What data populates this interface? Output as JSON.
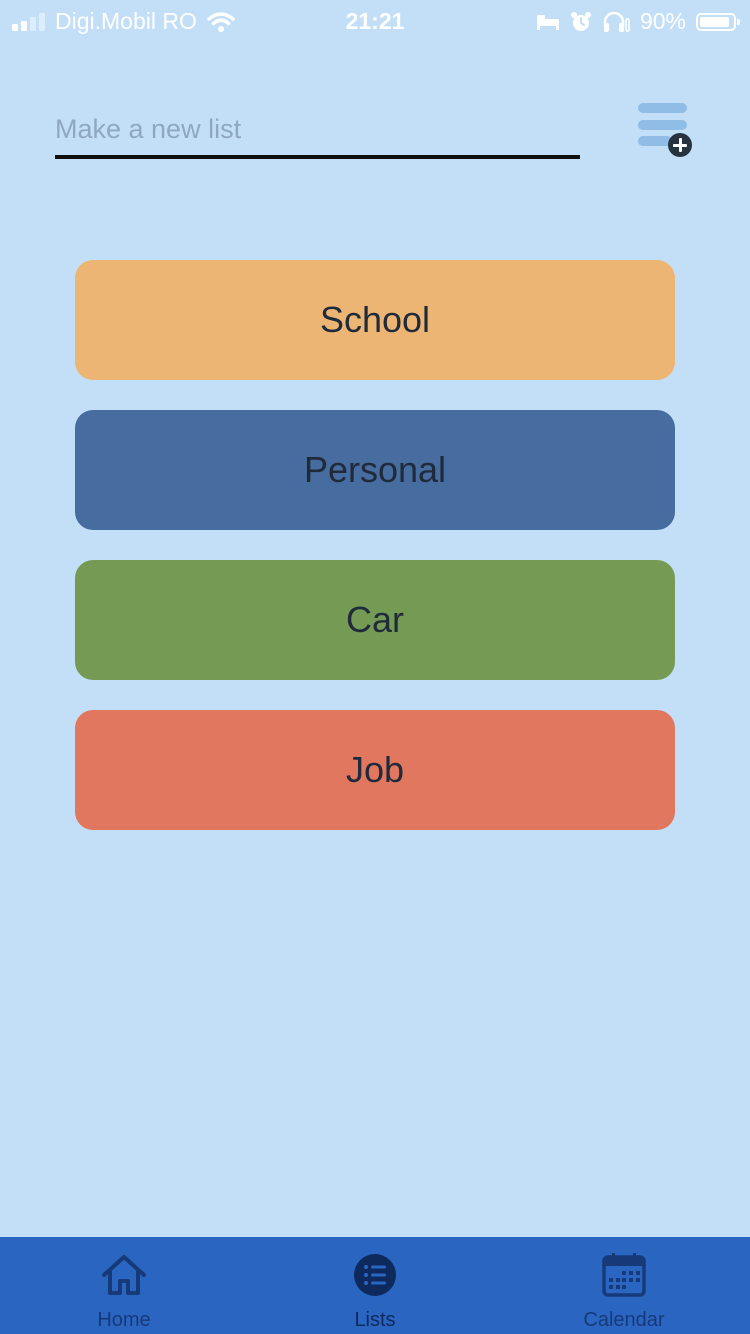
{
  "status_bar": {
    "carrier": "Digi.Mobil RO",
    "time": "21:21",
    "battery_percent": "90%",
    "battery_level": 0.9,
    "icons": [
      "signal-icon",
      "wifi-icon",
      "bed-icon",
      "alarm-icon",
      "headphones-icon",
      "battery-icon"
    ]
  },
  "new_list": {
    "placeholder": "Make a new list",
    "value": "",
    "add_icon": "add-list-icon"
  },
  "lists": [
    {
      "label": "School",
      "color": "#ecb574"
    },
    {
      "label": "Personal",
      "color": "#476c9f"
    },
    {
      "label": "Car",
      "color": "#759a54"
    },
    {
      "label": "Job",
      "color": "#e2775f"
    }
  ],
  "tab_bar": {
    "background": "#2b65c2",
    "tabs": [
      {
        "label": "Home",
        "icon": "home-icon",
        "active": false
      },
      {
        "label": "Lists",
        "icon": "list-icon",
        "active": true
      },
      {
        "label": "Calendar",
        "icon": "calendar-icon",
        "active": false
      }
    ]
  },
  "colors": {
    "background": "#c3dff7",
    "text": "#1f2a3a",
    "add_icon_bars": "#8fbde6"
  }
}
